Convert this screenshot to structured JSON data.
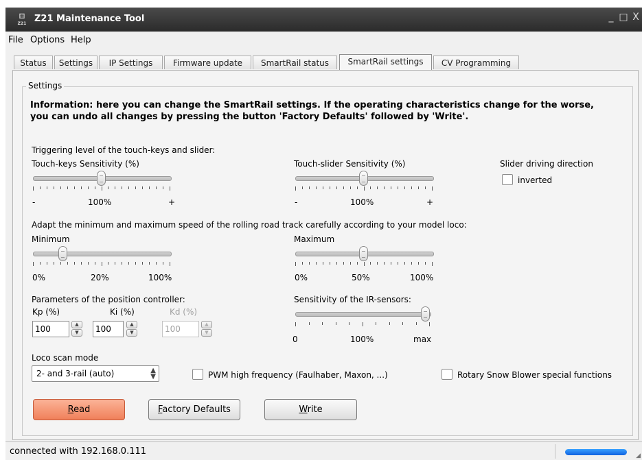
{
  "window": {
    "app_icon": "Z21",
    "title": "Z21 Maintenance Tool",
    "controls": {
      "minimize": "_",
      "maximize": "□",
      "close": "X"
    }
  },
  "menu": [
    "File",
    "Options",
    "Help"
  ],
  "tabs": [
    "Status",
    "Settings",
    "IP Settings",
    "Firmware update",
    "SmartRail status",
    "SmartRail settings",
    "CV Programming"
  ],
  "active_tab": "SmartRail settings",
  "group": {
    "title": "Settings",
    "info": "Information: here you can change the SmartRail settings. If the operating characteristics change for the worse, you can undo all changes by pressing the button 'Factory Defaults' followed by 'Write'."
  },
  "trigger": {
    "heading": "Triggering level of the touch-keys and slider:",
    "touch_keys": {
      "label": "Touch-keys Sensitivity (%)",
      "value_fraction": 0.5,
      "min_label": "-",
      "mid_label": "100%",
      "max_label": "+"
    },
    "touch_slider": {
      "label": "Touch-slider Sensitivity (%)",
      "value_fraction": 0.5,
      "min_label": "-",
      "mid_label": "100%",
      "max_label": "+"
    },
    "direction": {
      "label": "Slider driving direction",
      "checkbox_label": "inverted",
      "checked": false
    }
  },
  "speed": {
    "heading": "Adapt the minimum and maximum speed of the rolling road track carefully according to your model loco:",
    "minimum": {
      "label": "Minimum",
      "value_fraction": 0.2,
      "labels": [
        "0%",
        "20%",
        "100%"
      ]
    },
    "maximum": {
      "label": "Maximum",
      "value_fraction": 0.5,
      "labels": [
        "0%",
        "50%",
        "100%"
      ]
    }
  },
  "position_controller": {
    "heading": "Parameters of the position controller:",
    "kp": {
      "label": "Kp (%)",
      "value": "100",
      "enabled": true
    },
    "ki": {
      "label": "Ki (%)",
      "value": "100",
      "enabled": true
    },
    "kd": {
      "label": "Kd (%)",
      "value": "100",
      "enabled": false
    }
  },
  "ir_sensors": {
    "heading": "Sensitivity of the IR-sensors:",
    "value_fraction": 1.0,
    "labels": [
      "0",
      "100%",
      "max"
    ]
  },
  "loco_scan": {
    "label": "Loco scan mode",
    "selected": "2- and 3-rail (auto)"
  },
  "options": {
    "pwm": {
      "label": "PWM high frequency (Faulhaber, Maxon, ...)",
      "checked": false
    },
    "snow": {
      "label": "Rotary Snow Blower special functions",
      "checked": false
    }
  },
  "buttons": {
    "read": {
      "mnemonic": "R",
      "rest": "ead"
    },
    "factory": {
      "mnemonic": "F",
      "rest": "actory Defaults"
    },
    "write": {
      "mnemonic": "W",
      "rest": "rite"
    }
  },
  "status": {
    "text": "connected with 192.168.0.111"
  },
  "colors": {
    "title_bar": "#2b2b2b",
    "read_button": "#f0805a",
    "progress": "#1162e0"
  }
}
